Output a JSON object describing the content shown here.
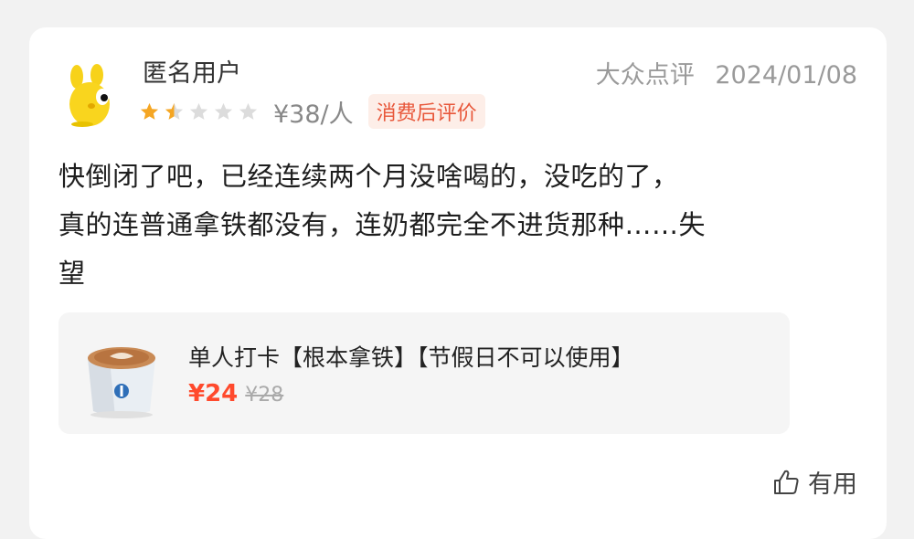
{
  "review": {
    "user_name": "匿名用户",
    "source": "大众点评",
    "date": "2024/01/08",
    "rating": 1.5,
    "rating_max": 5,
    "price_per_person": "¥38/人",
    "badge": "消费后评价",
    "text_line1": "快倒闭了吧，已经连续两个月没啥喝的，没吃的了，",
    "text_line2": "真的连普通拿铁都没有，连奶都完全不进货那种……失",
    "text_line3": "望",
    "colors": {
      "star_filled": "#f5a623",
      "star_empty": "#dcdcdc",
      "badge_text": "#e8573a",
      "price_accent": "#ff4a2d"
    }
  },
  "deal": {
    "title": "单人打卡【根本拿铁】【节假日不可以使用】",
    "price": "¥24",
    "original_price": "¥28",
    "image_icon": "coffee-cup-icon"
  },
  "actions": {
    "useful_label": "有用",
    "useful_icon": "thumbs-up-icon"
  }
}
